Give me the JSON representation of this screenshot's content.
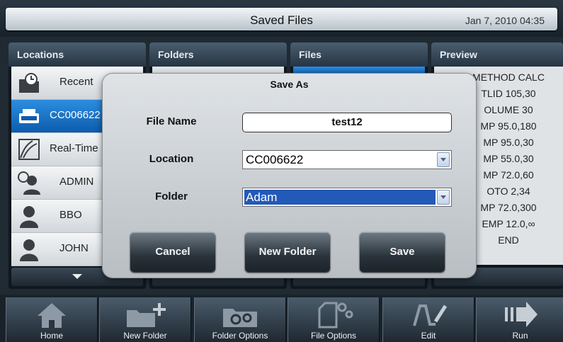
{
  "header": {
    "title": "Saved Files",
    "datetime": "Jan 7, 2010 04:35"
  },
  "panels": {
    "locations": {
      "title": "Locations"
    },
    "folders": {
      "title": "Folders"
    },
    "files": {
      "title": "Files"
    },
    "preview": {
      "title": "Preview"
    }
  },
  "locations": [
    {
      "label": "Recent",
      "icon": "recent-folder-icon"
    },
    {
      "label": "CC006622",
      "icon": "instrument-icon",
      "selected": true
    },
    {
      "label": "Real-Time D",
      "icon": "realtime-chart-icon"
    },
    {
      "label": "ADMIN",
      "icon": "admin-user-icon"
    },
    {
      "label": "BBO",
      "icon": "user-icon"
    },
    {
      "label": "JOHN",
      "icon": "user-icon"
    }
  ],
  "preview_lines": [
    "METHOD CALC",
    "TLID 105,30",
    "OLUME 30",
    "MP 95.0,180",
    "MP 95.0,30",
    "MP 55.0,30",
    "MP 72.0,60",
    "OTO 2,34",
    "MP 72.0,300",
    "EMP 12.0,∞",
    "END"
  ],
  "dialog": {
    "title": "Save As",
    "file_name_label": "File Name",
    "file_name_value": "test12",
    "location_label": "Location",
    "location_value": "CC006622",
    "folder_label": "Folder",
    "folder_value": "Adam",
    "cancel_label": "Cancel",
    "new_folder_label": "New Folder",
    "save_label": "Save"
  },
  "toolbar": [
    {
      "label": "Home",
      "icon": "home-icon"
    },
    {
      "label": "New Folder",
      "icon": "new-folder-icon"
    },
    {
      "label": "Folder Options",
      "icon": "folder-options-icon"
    },
    {
      "label": "File Options",
      "icon": "file-options-icon"
    },
    {
      "label": "Edit",
      "icon": "edit-icon"
    },
    {
      "label": "Run",
      "icon": "run-icon"
    }
  ]
}
